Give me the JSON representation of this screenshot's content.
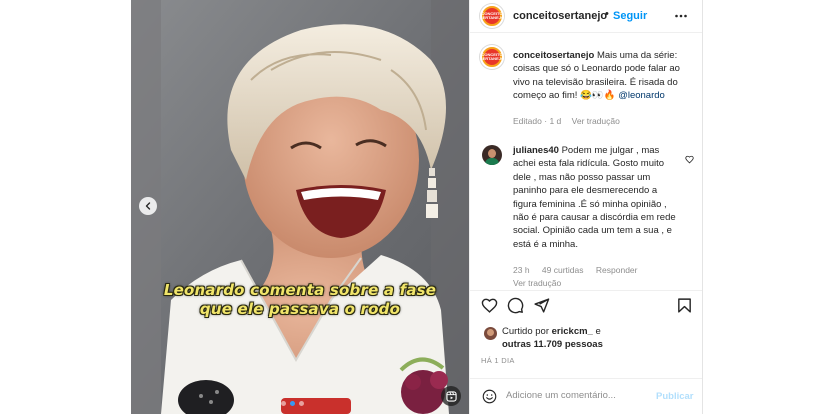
{
  "post_header": {
    "avatar_text": "CONCEITO SERTANEJO",
    "username": "conceitosertanejo",
    "separator": "•",
    "follow_label": "Seguir",
    "more_icon": "more-horizontal-icon"
  },
  "video": {
    "subtitle_line1": "Leonardo comenta sobre a fase",
    "subtitle_line2": "que ele passava o rodo",
    "prev_icon": "chevron-left-icon",
    "reels_icon": "reels-icon",
    "carousel_position": {
      "active": 1,
      "total": 3
    }
  },
  "caption": {
    "username": "conceitosertanejo",
    "text": "Mais uma da série: coisas que só o Leonardo pode falar ao vivo na televisão brasileira. É risada do começo ao fim! 😂👀🔥 ",
    "mention": "@leonardo",
    "edited": "Editado",
    "dot": "·",
    "time": "1 d",
    "translate": "Ver tradução"
  },
  "comment": {
    "username": "julianes40",
    "text": "Podem me julgar , mas achei esta fala ridícula. Gosto muito dele , mas não posso passar um paninho para ele desmerecendo a figura feminina .É só minha opinião , não é para causar a discórdia em rede social. Opinião cada um tem a sua , e está é a minha.",
    "time": "23 h",
    "likes": "49 curtidas",
    "reply": "Responder",
    "translate": "Ver tradução"
  },
  "actions": {
    "like_icon": "heart-icon",
    "comment_icon": "comment-icon",
    "share_icon": "share-icon",
    "save_icon": "bookmark-icon"
  },
  "liked_by": {
    "prefix": "Curtido por ",
    "user": "erickcm_",
    "middle": " e",
    "others": "outras 11.709 pessoas"
  },
  "date": "HÁ 1 DIA",
  "add_comment": {
    "emoji_icon": "emoji-icon",
    "placeholder": "Adicione um comentário...",
    "publish_label": "Publicar"
  },
  "colors": {
    "link": "#0095f6",
    "mention": "#00376b",
    "muted": "#8e8e8e",
    "publish_disabled": "#b2dffc",
    "subtitle": "#f1e56a",
    "brand_orange": "#f7a21b",
    "brand_red": "#e8362a"
  }
}
